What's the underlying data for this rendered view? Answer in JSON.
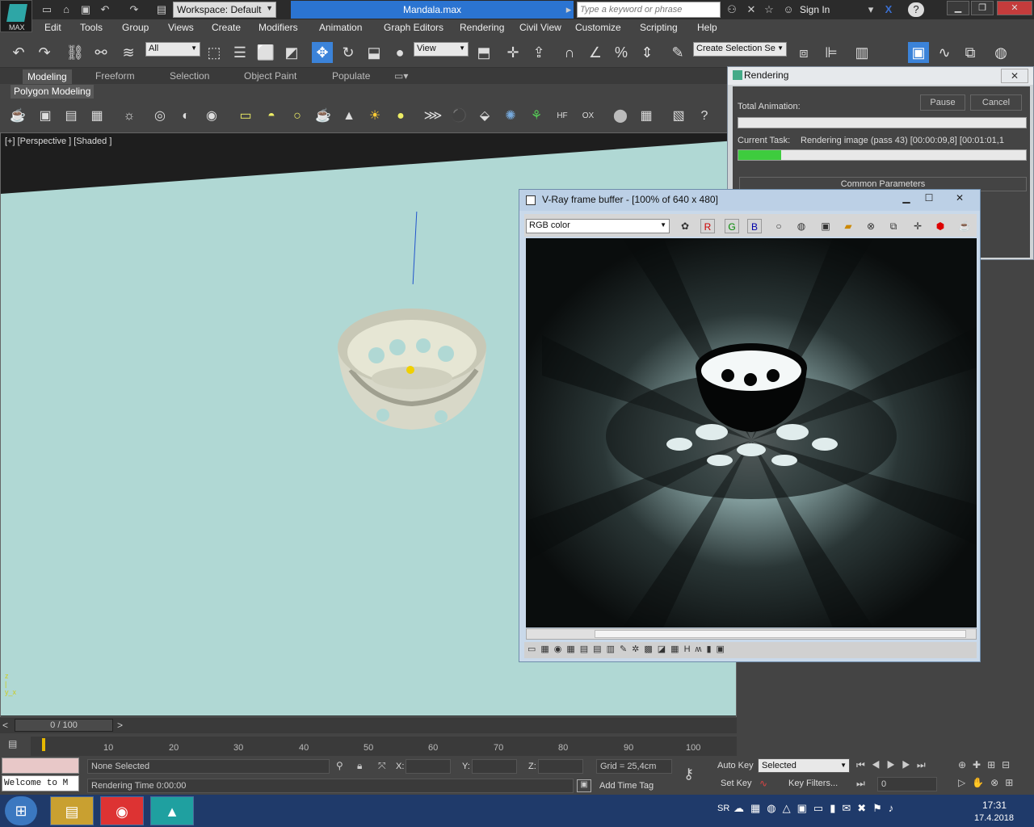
{
  "app": {
    "logo_text": "MAX",
    "workspace_label": "Workspace: Default",
    "doc_title": "Mandala.max",
    "search_placeholder": "Type a keyword or phrase",
    "signin": "Sign In"
  },
  "menu": [
    "Edit",
    "Tools",
    "Group",
    "Views",
    "Create",
    "Modifiers",
    "Animation",
    "Graph Editors",
    "Rendering",
    "Civil View",
    "Customize",
    "Scripting",
    "Help"
  ],
  "toolbar": {
    "filter_select": "All",
    "ref_coord_select": "View",
    "named_selection": "Create Selection Se"
  },
  "ribbon": {
    "tabs": [
      "Modeling",
      "Freeform",
      "Selection",
      "Object Paint",
      "Populate"
    ],
    "active_tab": "Modeling",
    "panel_label": "Polygon Modeling"
  },
  "viewport": {
    "label": "[+] [Perspective ] [Shaded ]"
  },
  "render_dialog": {
    "title": "Rendering",
    "total_label": "Total Animation:",
    "pause": "Pause",
    "cancel": "Cancel",
    "task_label": "Current Task:",
    "task_text": "Rendering image (pass 43) [00:00:09,8] [00:01:01,1",
    "task_progress": 0.15,
    "total_progress": 0,
    "section": "Common Parameters"
  },
  "vfb": {
    "title": "V-Ray frame buffer - [100% of 640 x 480]",
    "channel": "RGB color",
    "r": "R",
    "g": "G",
    "b": "B"
  },
  "timeline": {
    "slider": "0 / 100",
    "ticks": [
      "10",
      "20",
      "30",
      "40",
      "50",
      "60",
      "70",
      "80",
      "90",
      "100"
    ]
  },
  "status": {
    "maxscript": "Welcome to M",
    "selection": "None Selected",
    "render_time": "Rendering Time  0:00:00",
    "x_label": "X:",
    "y_label": "Y:",
    "z_label": "Z:",
    "grid": "Grid = 25,4cm",
    "add_time_tag": "Add Time Tag",
    "auto_key": "Auto Key",
    "set_key": "Set Key",
    "key_mode": "Selected",
    "key_filters": "Key Filters...",
    "frame": "0"
  },
  "tray": {
    "lang": "SR",
    "time": "17:31",
    "date": "17.4.2018"
  },
  "colors": {
    "accent": "#3b83d9",
    "progress": "#3ecc3e",
    "viewport_bg": "#b0d8d4"
  }
}
